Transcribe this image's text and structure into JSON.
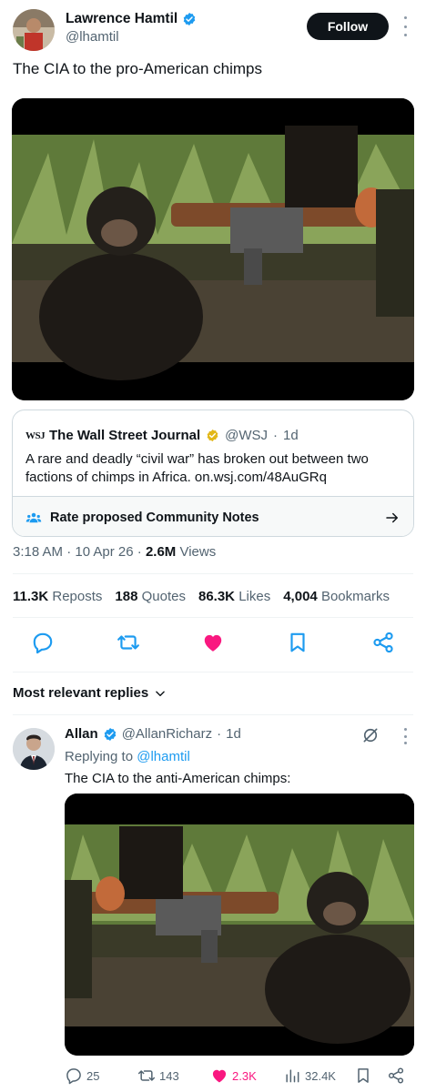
{
  "tweet": {
    "author_name": "Lawrence Hamtil",
    "author_handle": "@lhamtil",
    "follow_label": "Follow",
    "text": "The CIA to the pro-American chimps",
    "quote": {
      "logo_text": "WSJ",
      "name": "The Wall Street Journal",
      "handle": "@WSJ",
      "separator": "·",
      "time": "1d",
      "text": "A rare and deadly “civil war” has broken out between two factions of chimps in Africa. on.wsj.com/48AuGRq",
      "community_notes_label": "Rate proposed Community Notes"
    },
    "meta": {
      "time": "3:18 AM",
      "sep1": "·",
      "date": "10 Apr 26",
      "sep2": "·",
      "views_count": "2.6M",
      "views_label": "Views"
    },
    "stats": {
      "reposts_count": "11.3K",
      "reposts_label": "Reposts",
      "quotes_count": "188",
      "quotes_label": "Quotes",
      "likes_count": "86.3K",
      "likes_label": "Likes",
      "bookmarks_count": "4,004",
      "bookmarks_label": "Bookmarks"
    },
    "colors": {
      "like": "#f91880",
      "verified": "#1d9bf0",
      "gold": "#e2b719",
      "link": "#1d9bf0"
    }
  },
  "replies_header": "Most relevant replies",
  "reply": {
    "name": "Allan",
    "handle": "@AllanRicharz",
    "separator": "·",
    "time": "1d",
    "replying_prefix": "Replying to",
    "replying_to": "@lhamtil",
    "text": "The CIA to the anti-American chimps:",
    "counts": {
      "replies": "25",
      "reposts": "143",
      "likes": "2.3K",
      "views": "32.4K"
    }
  },
  "icons": [
    "verified-icon",
    "more-icon",
    "reply-icon",
    "repost-icon",
    "like-icon",
    "bookmark-icon",
    "share-icon",
    "chevron-down-icon",
    "grok-icon",
    "community-notes-icon",
    "arrow-right-icon",
    "views-icon"
  ]
}
